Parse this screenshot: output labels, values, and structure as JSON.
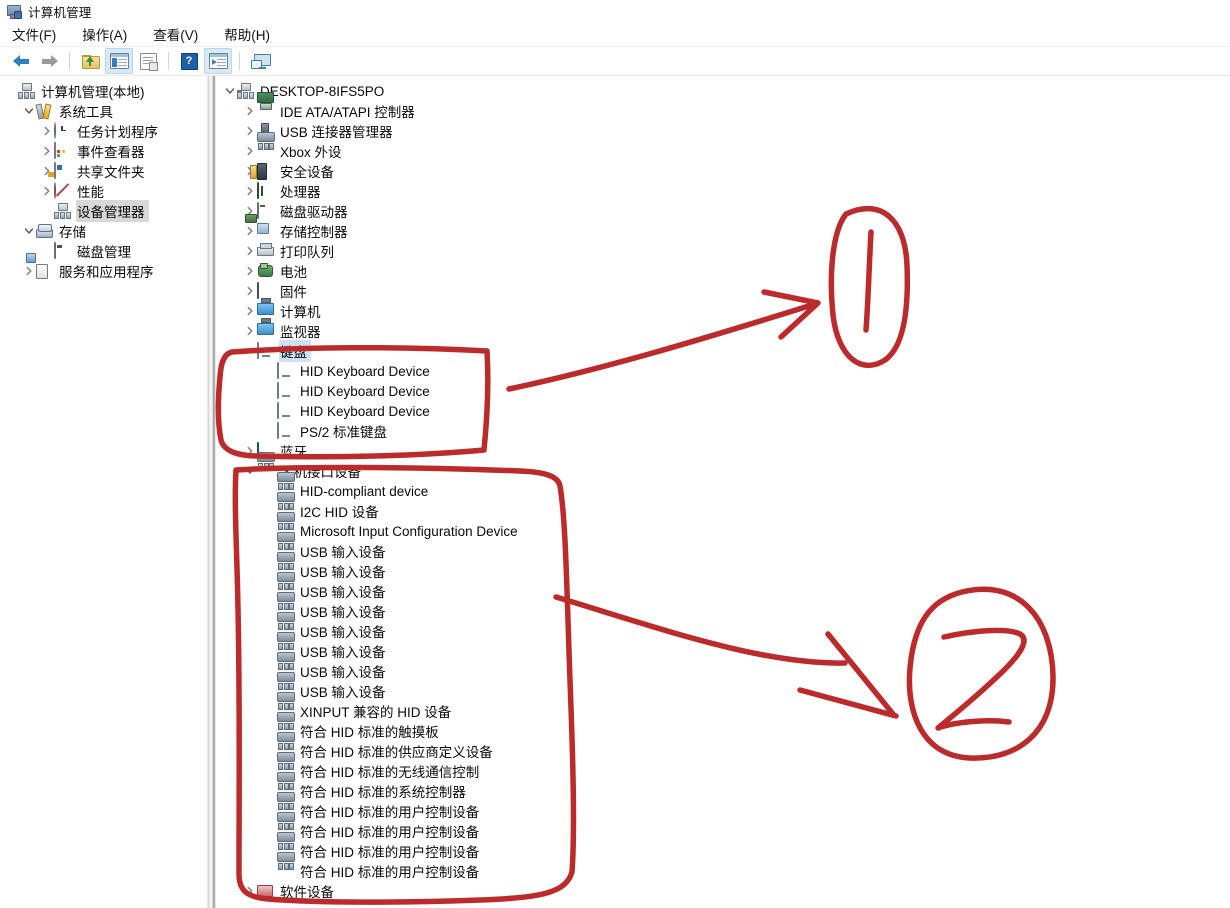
{
  "window": {
    "title": "计算机管理",
    "title_icon": "computer-management-icon"
  },
  "menu": {
    "items": [
      {
        "label": "文件(F)",
        "name": "menu-file"
      },
      {
        "label": "操作(A)",
        "name": "menu-action"
      },
      {
        "label": "查看(V)",
        "name": "menu-view"
      },
      {
        "label": "帮助(H)",
        "name": "menu-help"
      }
    ]
  },
  "toolbar": {
    "buttons": [
      {
        "name": "back-button",
        "icon": "back-arrow-icon",
        "title": "后退"
      },
      {
        "name": "forward-button",
        "icon": "forward-arrow-icon",
        "title": "前进"
      },
      {
        "name": "up-one-level-button",
        "icon": "folder-up-icon",
        "title": "上一级"
      },
      {
        "name": "show-hide-tree-button",
        "icon": "console-tree-icon",
        "title": "显示/隐藏控制台树"
      },
      {
        "name": "properties-button",
        "icon": "properties-icon",
        "title": "属性"
      },
      {
        "name": "help-button",
        "icon": "help-icon",
        "title": "帮助"
      },
      {
        "name": "action-pane-button",
        "icon": "action-pane-icon",
        "title": "操作窗格"
      },
      {
        "name": "remote-connect-button",
        "icon": "remote-desktop-icon",
        "title": "连接到另一台计算机"
      }
    ]
  },
  "left_tree": {
    "nodes": [
      {
        "label": "计算机管理(本地)",
        "indent": 0,
        "twisty": "none",
        "icon": "computer-management-icon",
        "selected": false
      },
      {
        "label": "系统工具",
        "indent": 1,
        "twisty": "expanded",
        "icon": "system-tools-icon",
        "selected": false
      },
      {
        "label": "任务计划程序",
        "indent": 2,
        "twisty": "collapsed",
        "icon": "task-scheduler-icon",
        "selected": false
      },
      {
        "label": "事件查看器",
        "indent": 2,
        "twisty": "collapsed",
        "icon": "event-viewer-icon",
        "selected": false
      },
      {
        "label": "共享文件夹",
        "indent": 2,
        "twisty": "collapsed",
        "icon": "shared-folders-icon",
        "selected": false
      },
      {
        "label": "性能",
        "indent": 2,
        "twisty": "collapsed",
        "icon": "performance-icon",
        "selected": false
      },
      {
        "label": "设备管理器",
        "indent": 2,
        "twisty": "none",
        "icon": "device-manager-icon",
        "selected": true
      },
      {
        "label": "存储",
        "indent": 1,
        "twisty": "expanded",
        "icon": "storage-icon",
        "selected": false
      },
      {
        "label": "磁盘管理",
        "indent": 2,
        "twisty": "none",
        "icon": "disk-management-icon",
        "selected": false
      },
      {
        "label": "服务和应用程序",
        "indent": 1,
        "twisty": "collapsed",
        "icon": "services-and-applications-icon",
        "selected": false
      }
    ]
  },
  "device_tree": {
    "nodes": [
      {
        "label": "DESKTOP-8IFS5PO",
        "indent": 0,
        "twisty": "expanded",
        "icon": "computer-icon",
        "selected": false
      },
      {
        "label": "IDE ATA/ATAPI 控制器",
        "indent": 1,
        "twisty": "collapsed",
        "icon": "ide-controller-icon",
        "selected": false
      },
      {
        "label": "USB 连接器管理器",
        "indent": 1,
        "twisty": "collapsed",
        "icon": "usb-connector-icon",
        "selected": false
      },
      {
        "label": "Xbox 外设",
        "indent": 1,
        "twisty": "collapsed",
        "icon": "xbox-peripheral-icon",
        "selected": false
      },
      {
        "label": "安全设备",
        "indent": 1,
        "twisty": "collapsed",
        "icon": "security-device-icon",
        "selected": false
      },
      {
        "label": "处理器",
        "indent": 1,
        "twisty": "collapsed",
        "icon": "processor-icon",
        "selected": false
      },
      {
        "label": "磁盘驱动器",
        "indent": 1,
        "twisty": "collapsed",
        "icon": "disk-drive-icon",
        "selected": false
      },
      {
        "label": "存储控制器",
        "indent": 1,
        "twisty": "collapsed",
        "icon": "storage-controller-icon",
        "selected": false
      },
      {
        "label": "打印队列",
        "indent": 1,
        "twisty": "collapsed",
        "icon": "print-queue-icon",
        "selected": false
      },
      {
        "label": "电池",
        "indent": 1,
        "twisty": "collapsed",
        "icon": "battery-icon",
        "selected": false
      },
      {
        "label": "固件",
        "indent": 1,
        "twisty": "collapsed",
        "icon": "firmware-icon",
        "selected": false
      },
      {
        "label": "计算机",
        "indent": 1,
        "twisty": "collapsed",
        "icon": "computer-category-icon",
        "selected": false
      },
      {
        "label": "监视器",
        "indent": 1,
        "twisty": "collapsed",
        "icon": "monitor-icon",
        "selected": false
      },
      {
        "label": "键盘",
        "indent": 1,
        "twisty": "expanded",
        "icon": "keyboard-category-icon",
        "selected": true
      },
      {
        "label": "HID Keyboard Device",
        "indent": 2,
        "twisty": "none",
        "icon": "keyboard-device-icon",
        "selected": false
      },
      {
        "label": "HID Keyboard Device",
        "indent": 2,
        "twisty": "none",
        "icon": "keyboard-device-icon",
        "selected": false
      },
      {
        "label": "HID Keyboard Device",
        "indent": 2,
        "twisty": "none",
        "icon": "keyboard-device-icon",
        "selected": false
      },
      {
        "label": "PS/2 标准键盘",
        "indent": 2,
        "twisty": "none",
        "icon": "keyboard-device-icon",
        "selected": false
      },
      {
        "label": "蓝牙",
        "indent": 1,
        "twisty": "collapsed",
        "icon": "bluetooth-icon",
        "selected": false
      },
      {
        "label": "人机接口设备",
        "indent": 1,
        "twisty": "expanded",
        "icon": "hid-category-icon",
        "selected": false
      },
      {
        "label": "HID-compliant device",
        "indent": 2,
        "twisty": "none",
        "icon": "hid-device-icon",
        "selected": false
      },
      {
        "label": "I2C HID 设备",
        "indent": 2,
        "twisty": "none",
        "icon": "hid-device-icon",
        "selected": false
      },
      {
        "label": "Microsoft Input Configuration Device",
        "indent": 2,
        "twisty": "none",
        "icon": "hid-device-icon",
        "selected": false
      },
      {
        "label": "USB 输入设备",
        "indent": 2,
        "twisty": "none",
        "icon": "hid-device-icon",
        "selected": false
      },
      {
        "label": "USB 输入设备",
        "indent": 2,
        "twisty": "none",
        "icon": "hid-device-icon",
        "selected": false
      },
      {
        "label": "USB 输入设备",
        "indent": 2,
        "twisty": "none",
        "icon": "hid-device-icon",
        "selected": false
      },
      {
        "label": "USB 输入设备",
        "indent": 2,
        "twisty": "none",
        "icon": "hid-device-icon",
        "selected": false
      },
      {
        "label": "USB 输入设备",
        "indent": 2,
        "twisty": "none",
        "icon": "hid-device-icon",
        "selected": false
      },
      {
        "label": "USB 输入设备",
        "indent": 2,
        "twisty": "none",
        "icon": "hid-device-icon",
        "selected": false
      },
      {
        "label": "USB 输入设备",
        "indent": 2,
        "twisty": "none",
        "icon": "hid-device-icon",
        "selected": false
      },
      {
        "label": "USB 输入设备",
        "indent": 2,
        "twisty": "none",
        "icon": "hid-device-icon",
        "selected": false
      },
      {
        "label": "XINPUT 兼容的 HID 设备",
        "indent": 2,
        "twisty": "none",
        "icon": "hid-device-icon",
        "selected": false
      },
      {
        "label": "符合 HID 标准的触摸板",
        "indent": 2,
        "twisty": "none",
        "icon": "hid-device-icon",
        "selected": false
      },
      {
        "label": "符合 HID 标准的供应商定义设备",
        "indent": 2,
        "twisty": "none",
        "icon": "hid-device-icon",
        "selected": false
      },
      {
        "label": "符合 HID 标准的无线通信控制",
        "indent": 2,
        "twisty": "none",
        "icon": "hid-device-icon",
        "selected": false
      },
      {
        "label": "符合 HID 标准的系统控制器",
        "indent": 2,
        "twisty": "none",
        "icon": "hid-device-icon",
        "selected": false
      },
      {
        "label": "符合 HID 标准的用户控制设备",
        "indent": 2,
        "twisty": "none",
        "icon": "hid-device-icon",
        "selected": false
      },
      {
        "label": "符合 HID 标准的用户控制设备",
        "indent": 2,
        "twisty": "none",
        "icon": "hid-device-icon",
        "selected": false
      },
      {
        "label": "符合 HID 标准的用户控制设备",
        "indent": 2,
        "twisty": "none",
        "icon": "hid-device-icon",
        "selected": false
      },
      {
        "label": "符合 HID 标准的用户控制设备",
        "indent": 2,
        "twisty": "none",
        "icon": "hid-device-icon",
        "selected": false
      },
      {
        "label": "软件设备",
        "indent": 1,
        "twisty": "collapsed",
        "icon": "software-device-icon",
        "selected": false
      }
    ]
  },
  "annotations": {
    "color": "#bb2b2b",
    "marks": [
      {
        "name": "annotation-box-keyboard",
        "type": "box",
        "target": "键盘"
      },
      {
        "name": "annotation-box-hid",
        "type": "box",
        "target": "人机接口设备"
      },
      {
        "name": "annotation-arrow-1",
        "type": "arrow"
      },
      {
        "name": "annotation-circle-1",
        "type": "circled-number",
        "text": "1"
      },
      {
        "name": "annotation-arrow-2",
        "type": "arrow"
      },
      {
        "name": "annotation-circle-2",
        "type": "circled-number",
        "text": "2"
      }
    ]
  }
}
